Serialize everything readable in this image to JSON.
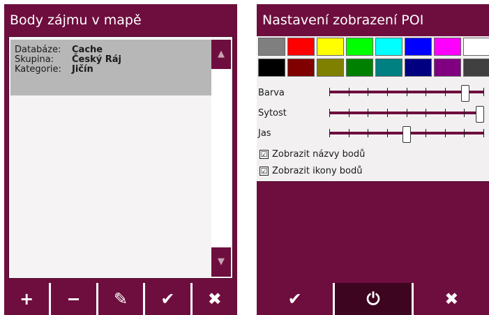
{
  "left": {
    "title": "Body zájmu v mapě",
    "item": {
      "db_key": "Databáze:",
      "db_val": "Cache",
      "group_key": "Skupina:",
      "group_val": "Český Ráj",
      "cat_key": "Kategorie:",
      "cat_val": "Jičín"
    },
    "buttons": {
      "add": "+",
      "remove": "−",
      "edit": "✎",
      "ok": "✔",
      "close": "✖"
    }
  },
  "right": {
    "title": "Nastavení zobrazení POI",
    "swatches": [
      "#7f7f7f",
      "#ff0000",
      "#ffff00",
      "#00ff00",
      "#00ffff",
      "#0000ff",
      "#ff00ff",
      "#ffffff",
      "#000000",
      "#800000",
      "#808000",
      "#008000",
      "#008080",
      "#000080",
      "#800080",
      "#404040"
    ],
    "sliders": {
      "hue_label": "Barva",
      "hue_level": 0.9,
      "saturation_label": "Sytost",
      "saturation_level": 1.0,
      "brightness_label": "Jas",
      "brightness_level": 0.5
    },
    "checkboxes": {
      "show_names": "Zobrazit názvy bodů",
      "show_icons": "Zobrazit ikony bodů",
      "mark": "☑"
    },
    "buttons": {
      "ok": "✔",
      "power": "⏻",
      "close": "✖"
    }
  },
  "colors": {
    "accent": "#6e0e3e",
    "accent_dark": "#3d0520",
    "selected_row": "#b7b7b7"
  }
}
